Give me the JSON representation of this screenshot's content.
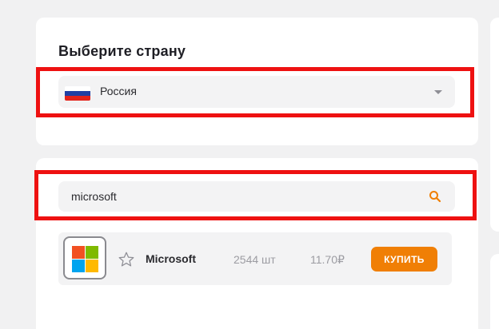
{
  "country_section": {
    "title": "Выберите страну",
    "selected_country": "Россия",
    "flag_icon": "russia-flag-icon"
  },
  "search": {
    "value": "microsoft",
    "icon": "search-icon",
    "icon_color": "#f07f05"
  },
  "results": [
    {
      "name": "Microsoft",
      "quantity": "2544 шт",
      "price": "11.70₽",
      "buy_label": "КУПИТЬ",
      "icon": "microsoft-logo-icon"
    }
  ],
  "colors": {
    "accent": "#f07f05",
    "highlight": "#ee1111",
    "background": "#f1f1f2"
  }
}
